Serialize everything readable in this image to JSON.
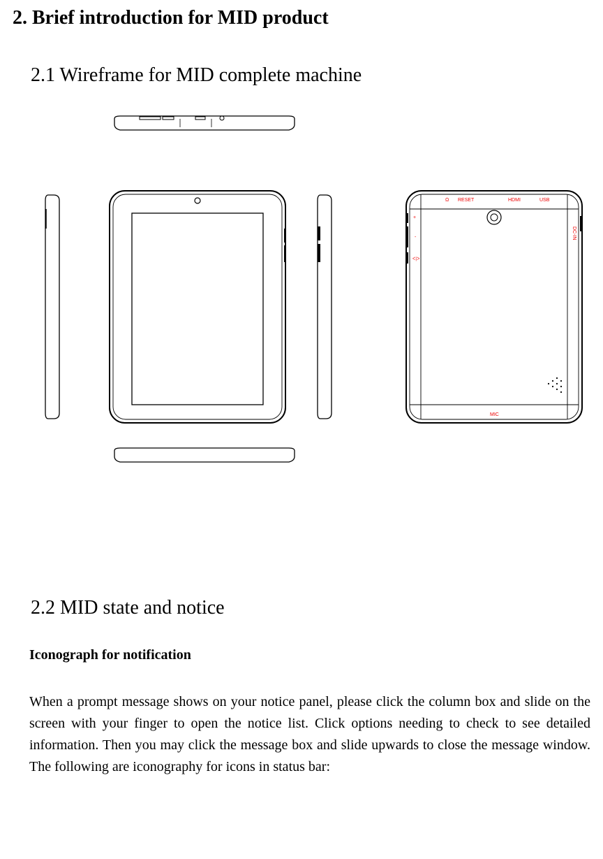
{
  "heading": "2. Brief introduction for MID product",
  "sub21": "2.1 Wireframe for MID complete machine",
  "sub22": "2.2 MID state and notice",
  "iconograph_heading": "Iconograph for notification",
  "paragraph": "When a prompt message shows on your notice panel, please click the column box and slide on the screen with your finger to open the notice list. Click options needing to check to see detailed information. Then you may click the message box and slide upwards to close the message window. The following are iconography for icons in status bar:",
  "labels": {
    "headphone_icon": "Ω",
    "reset": "RESET",
    "hdmi": "HDMI",
    "usb": "USB",
    "dcin": "DC-IN",
    "plus": "+",
    "minus": "-",
    "power": "ᐸ|ᐳ",
    "mic": "MIC"
  }
}
